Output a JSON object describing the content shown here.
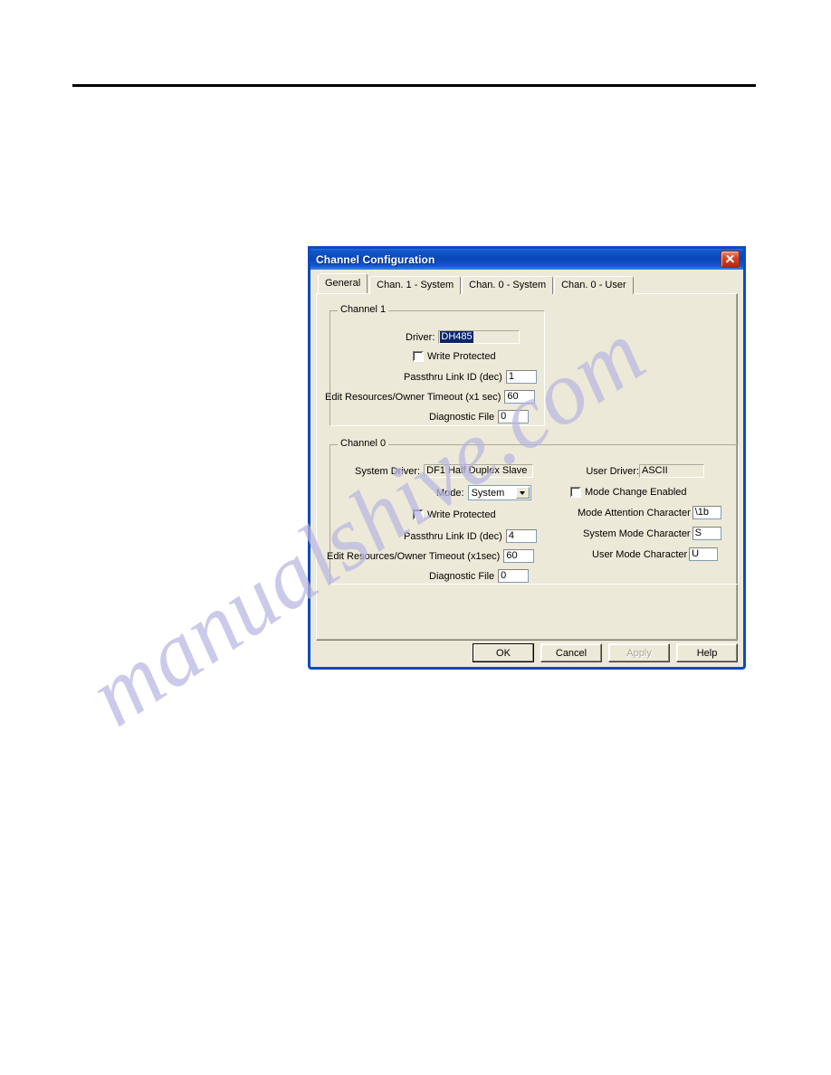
{
  "page": {
    "rule": "horizontal-rule",
    "watermark": "manualshive.com"
  },
  "dialog": {
    "title": "Channel Configuration",
    "close_icon": "close-icon",
    "tabs": [
      {
        "label": "General",
        "active": true
      },
      {
        "label": "Chan. 1 - System",
        "active": false
      },
      {
        "label": "Chan. 0 - System",
        "active": false
      },
      {
        "label": "Chan. 0 - User",
        "active": false
      }
    ],
    "channel1": {
      "title": "Channel 1",
      "driver_label": "Driver:",
      "driver_value": "DH485",
      "write_protected_label": "Write Protected",
      "write_protected_checked": false,
      "passthru_label": "Passthru Link ID (dec)",
      "passthru_value": "1",
      "edit_timeout_label": "Edit Resources/Owner Timeout (x1 sec)",
      "edit_timeout_value": "60",
      "diagnostic_label": "Diagnostic File",
      "diagnostic_value": "0"
    },
    "channel0": {
      "title": "Channel 0",
      "system_driver_label": "System Driver:",
      "system_driver_value": "DF1 Half Duplex Slave",
      "mode_label": "Mode:",
      "mode_value": "System",
      "write_protected_label": "Write Protected",
      "write_protected_checked": false,
      "passthru_label": "Passthru Link ID (dec)",
      "passthru_value": "4",
      "edit_timeout_label": "Edit Resources/Owner Timeout (x1sec)",
      "edit_timeout_value": "60",
      "diagnostic_label": "Diagnostic File",
      "diagnostic_value": "0",
      "user_driver_label": "User Driver:",
      "user_driver_value": "ASCII",
      "mode_change_label": "Mode Change Enabled",
      "mode_change_checked": false,
      "mode_attention_label": "Mode Attention Character",
      "mode_attention_value": "\\1b",
      "system_mode_label": "System Mode Character",
      "system_mode_value": "S",
      "user_mode_label": "User Mode Character",
      "user_mode_value": "U"
    },
    "buttons": {
      "ok": "OK",
      "cancel": "Cancel",
      "apply": "Apply",
      "help": "Help"
    },
    "colors": {
      "titlebar": "#0a47b8",
      "dialog_face": "#ece9d8",
      "selection": "#0a246a",
      "watermark": "#b9b6e2"
    }
  }
}
